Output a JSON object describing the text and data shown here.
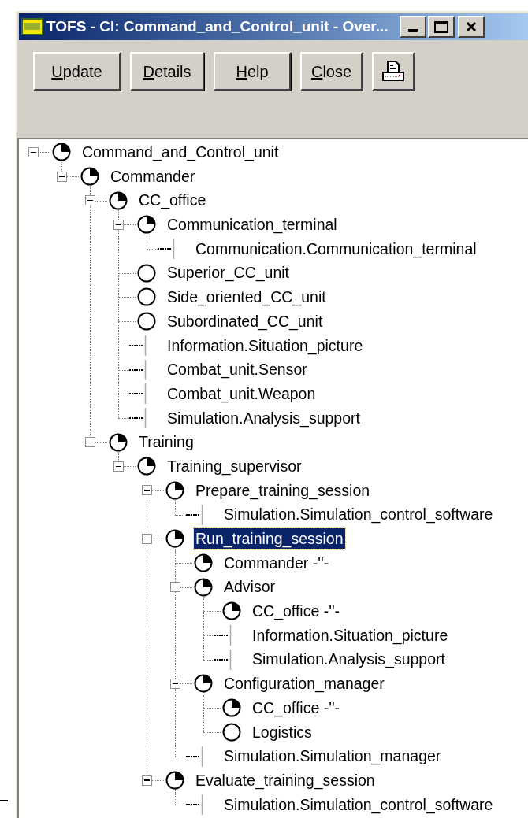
{
  "window": {
    "title": "TOFS - CI: Command_and_Control_unit - Over..."
  },
  "toolbar": {
    "buttons": [
      {
        "kind": "text",
        "label": "Update"
      },
      {
        "kind": "text",
        "label": "Details"
      },
      {
        "kind": "text",
        "label": "Help"
      },
      {
        "kind": "text",
        "label": "Close"
      },
      {
        "kind": "print"
      }
    ]
  },
  "tree": [
    {
      "label": "Command_and_Control_unit",
      "kind": "partial",
      "expanded": true,
      "selected": false,
      "children": [
        {
          "label": "Commander",
          "kind": "partial",
          "expanded": true,
          "selected": false,
          "children": [
            {
              "label": "CC_office",
              "kind": "partial",
              "expanded": true,
              "selected": false,
              "children": [
                {
                  "label": "Communication_terminal",
                  "kind": "partial",
                  "expanded": true,
                  "selected": false,
                  "children": [
                    {
                      "label": "Communication.Communication_terminal",
                      "kind": "link",
                      "selected": false
                    }
                  ]
                },
                {
                  "label": "Superior_CC_unit",
                  "kind": "empty",
                  "selected": false
                },
                {
                  "label": "Side_oriented_CC_unit",
                  "kind": "empty",
                  "selected": false
                },
                {
                  "label": "Subordinated_CC_unit",
                  "kind": "empty",
                  "selected": false
                },
                {
                  "label": "Information.Situation_picture",
                  "kind": "link",
                  "selected": false
                },
                {
                  "label": "Combat_unit.Sensor",
                  "kind": "link",
                  "selected": false
                },
                {
                  "label": "Combat_unit.Weapon",
                  "kind": "link",
                  "selected": false
                },
                {
                  "label": "Simulation.Analysis_support",
                  "kind": "link",
                  "selected": false
                }
              ]
            },
            {
              "label": "Training",
              "kind": "partial",
              "expanded": true,
              "selected": false,
              "children": [
                {
                  "label": "Training_supervisor",
                  "kind": "partial",
                  "expanded": true,
                  "selected": false,
                  "children": [
                    {
                      "label": "Prepare_training_session",
                      "kind": "partial",
                      "expanded": true,
                      "selected": false,
                      "children": [
                        {
                          "label": "Simulation.Simulation_control_software",
                          "kind": "link",
                          "selected": false
                        }
                      ]
                    },
                    {
                      "label": "Run_training_session",
                      "kind": "partial",
                      "expanded": true,
                      "selected": true,
                      "children": [
                        {
                          "label": "Commander -''-",
                          "kind": "partial",
                          "selected": false
                        },
                        {
                          "label": "Advisor",
                          "kind": "partial",
                          "expanded": true,
                          "selected": false,
                          "children": [
                            {
                              "label": "CC_office -''-",
                              "kind": "partial",
                              "selected": false
                            },
                            {
                              "label": "Information.Situation_picture",
                              "kind": "link",
                              "selected": false
                            },
                            {
                              "label": "Simulation.Analysis_support",
                              "kind": "link",
                              "selected": false
                            }
                          ]
                        },
                        {
                          "label": "Configuration_manager",
                          "kind": "partial",
                          "expanded": true,
                          "selected": false,
                          "children": [
                            {
                              "label": "CC_office -''-",
                              "kind": "partial",
                              "selected": false
                            },
                            {
                              "label": "Logistics",
                              "kind": "empty",
                              "selected": false
                            }
                          ]
                        },
                        {
                          "label": "Simulation.Simulation_manager",
                          "kind": "link",
                          "selected": false
                        }
                      ]
                    },
                    {
                      "label": "Evaluate_training_session",
                      "kind": "partial",
                      "expanded": true,
                      "selected": false,
                      "children": [
                        {
                          "label": "Simulation.Simulation_control_software",
                          "kind": "link",
                          "selected": false
                        }
                      ]
                    }
                  ]
                }
              ]
            }
          ]
        }
      ]
    }
  ]
}
